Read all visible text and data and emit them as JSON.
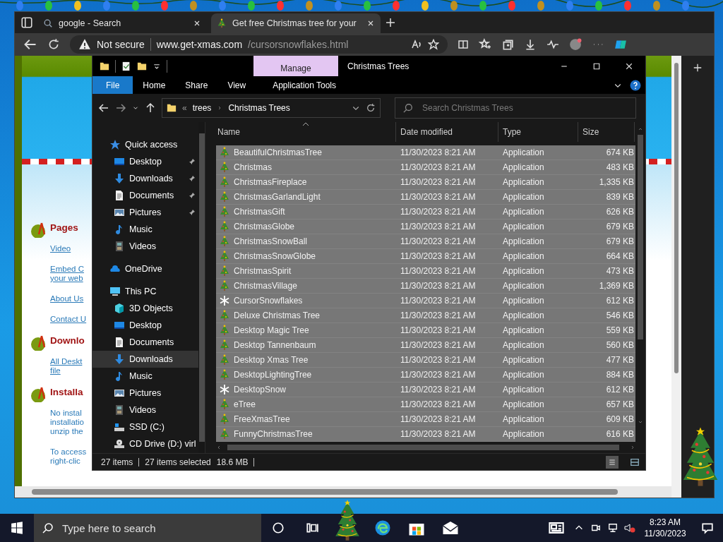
{
  "browser": {
    "tabs": [
      {
        "title": "google - Search",
        "selected": false
      },
      {
        "title": "Get free Christmas tree for your",
        "selected": true
      }
    ],
    "security": "Not secure",
    "url_host": "www.get-xmas.com",
    "url_path": "/cursorsnowflakes.html"
  },
  "webpage": {
    "sections": [
      {
        "heading": "Pages",
        "items": [
          {
            "kind": "link",
            "lines": [
              "Video"
            ]
          },
          {
            "kind": "link",
            "lines": [
              "Embed C",
              "your web"
            ]
          },
          {
            "kind": "link",
            "lines": [
              "About Us"
            ]
          },
          {
            "kind": "link",
            "lines": [
              "Contact U"
            ]
          }
        ]
      },
      {
        "heading": "Downlo",
        "items": [
          {
            "kind": "link",
            "lines": [
              "All Deskt",
              "file"
            ]
          }
        ]
      },
      {
        "heading": "Installa",
        "items": [
          {
            "kind": "note",
            "lines": [
              "No instal",
              "installatio",
              "unzip the"
            ]
          },
          {
            "kind": "note",
            "lines": [
              "To access",
              "right-clic"
            ]
          }
        ]
      }
    ]
  },
  "explorer": {
    "title": "Christmas Trees",
    "context_tab": "Manage",
    "ribbon_tabs": [
      {
        "label": "File",
        "kind": "menu"
      },
      {
        "label": "Home",
        "kind": "tab"
      },
      {
        "label": "Share",
        "kind": "tab"
      },
      {
        "label": "View",
        "kind": "tab"
      },
      {
        "label": "Application Tools",
        "kind": "tab"
      }
    ],
    "breadcrumb": {
      "overflow": "«",
      "parts": [
        "trees",
        "Christmas Trees"
      ]
    },
    "search": {
      "placeholder": "Search Christmas Trees"
    },
    "nav": [
      {
        "label": "Quick access",
        "kind": "star",
        "selected": false,
        "children": [
          {
            "label": "Desktop",
            "kind": "desktop",
            "pinned": true,
            "selected": false
          },
          {
            "label": "Downloads",
            "kind": "download",
            "pinned": true,
            "selected": false
          },
          {
            "label": "Documents",
            "kind": "document",
            "pinned": true,
            "selected": false
          },
          {
            "label": "Pictures",
            "kind": "picture",
            "pinned": true,
            "selected": false
          },
          {
            "label": "Music",
            "kind": "music",
            "pinned": false,
            "selected": false
          },
          {
            "label": "Videos",
            "kind": "video",
            "pinned": false,
            "selected": false
          }
        ]
      },
      {
        "label": "OneDrive",
        "kind": "cloud",
        "selected": false
      },
      {
        "label": "This PC",
        "kind": "pc",
        "selected": false,
        "children": [
          {
            "label": "3D Objects",
            "kind": "cube",
            "selected": false
          },
          {
            "label": "Desktop",
            "kind": "desktop",
            "selected": false
          },
          {
            "label": "Documents",
            "kind": "document",
            "selected": false
          },
          {
            "label": "Downloads",
            "kind": "download",
            "selected": true
          },
          {
            "label": "Music",
            "kind": "music",
            "selected": false
          },
          {
            "label": "Pictures",
            "kind": "picture",
            "selected": false
          },
          {
            "label": "Videos",
            "kind": "video",
            "selected": false
          },
          {
            "label": "SSD (C:)",
            "kind": "drive",
            "selected": false
          },
          {
            "label": "CD Drive (D:) virl",
            "kind": "cd",
            "selected": false
          }
        ]
      }
    ],
    "columns": [
      "Name",
      "Date modified",
      "Type",
      "Size"
    ],
    "files": [
      {
        "name": "BeautifulChristmasTree",
        "date": "11/30/2023 8:21 AM",
        "type": "Application",
        "size": "674 KB",
        "kind": "tree",
        "selected": true
      },
      {
        "name": "Christmas",
        "date": "11/30/2023 8:21 AM",
        "type": "Application",
        "size": "483 KB",
        "kind": "tree",
        "selected": true
      },
      {
        "name": "ChristmasFireplace",
        "date": "11/30/2023 8:21 AM",
        "type": "Application",
        "size": "1,335 KB",
        "kind": "tree",
        "selected": true
      },
      {
        "name": "ChristmasGarlandLight",
        "date": "11/30/2023 8:21 AM",
        "type": "Application",
        "size": "839 KB",
        "kind": "tree",
        "selected": true
      },
      {
        "name": "ChristmasGift",
        "date": "11/30/2023 8:21 AM",
        "type": "Application",
        "size": "626 KB",
        "kind": "tree",
        "selected": true
      },
      {
        "name": "ChristmasGlobe",
        "date": "11/30/2023 8:21 AM",
        "type": "Application",
        "size": "679 KB",
        "kind": "tree",
        "selected": true
      },
      {
        "name": "ChristmasSnowBall",
        "date": "11/30/2023 8:21 AM",
        "type": "Application",
        "size": "679 KB",
        "kind": "tree",
        "selected": true
      },
      {
        "name": "ChristmasSnowGlobe",
        "date": "11/30/2023 8:21 AM",
        "type": "Application",
        "size": "664 KB",
        "kind": "tree",
        "selected": true
      },
      {
        "name": "ChristmasSpirit",
        "date": "11/30/2023 8:21 AM",
        "type": "Application",
        "size": "473 KB",
        "kind": "tree",
        "selected": true
      },
      {
        "name": "ChristmasVillage",
        "date": "11/30/2023 8:21 AM",
        "type": "Application",
        "size": "1,369 KB",
        "kind": "tree",
        "selected": true
      },
      {
        "name": "CursorSnowflakes",
        "date": "11/30/2023 8:21 AM",
        "type": "Application",
        "size": "612 KB",
        "kind": "snowflake",
        "selected": true
      },
      {
        "name": "Deluxe Christmas Tree",
        "date": "11/30/2023 8:21 AM",
        "type": "Application",
        "size": "546 KB",
        "kind": "tree",
        "selected": true
      },
      {
        "name": "Desktop Magic Tree",
        "date": "11/30/2023 8:21 AM",
        "type": "Application",
        "size": "559 KB",
        "kind": "tree",
        "selected": true
      },
      {
        "name": "Desktop Tannenbaum",
        "date": "11/30/2023 8:21 AM",
        "type": "Application",
        "size": "560 KB",
        "kind": "tree",
        "selected": true
      },
      {
        "name": "Desktop Xmas Tree",
        "date": "11/30/2023 8:21 AM",
        "type": "Application",
        "size": "477 KB",
        "kind": "tree",
        "selected": true
      },
      {
        "name": "DesktopLightingTree",
        "date": "11/30/2023 8:21 AM",
        "type": "Application",
        "size": "884 KB",
        "kind": "tree",
        "selected": true
      },
      {
        "name": "DesktopSnow",
        "date": "11/30/2023 8:21 AM",
        "type": "Application",
        "size": "612 KB",
        "kind": "snowflake",
        "selected": true
      },
      {
        "name": "eTree",
        "date": "11/30/2023 8:21 AM",
        "type": "Application",
        "size": "657 KB",
        "kind": "tree",
        "selected": true
      },
      {
        "name": "FreeXmasTree",
        "date": "11/30/2023 8:21 AM",
        "type": "Application",
        "size": "609 KB",
        "kind": "tree",
        "selected": true
      },
      {
        "name": "FunnyChristmasTree",
        "date": "11/30/2023 8:21 AM",
        "type": "Application",
        "size": "616 KB",
        "kind": "tree",
        "selected": true
      }
    ],
    "status": {
      "count": "27 items",
      "selected": "27 items selected",
      "size": "18.6 MB"
    }
  },
  "taskbar": {
    "search_placeholder": "Type here to search",
    "time": "8:23 AM",
    "date": "11/30/2023"
  }
}
